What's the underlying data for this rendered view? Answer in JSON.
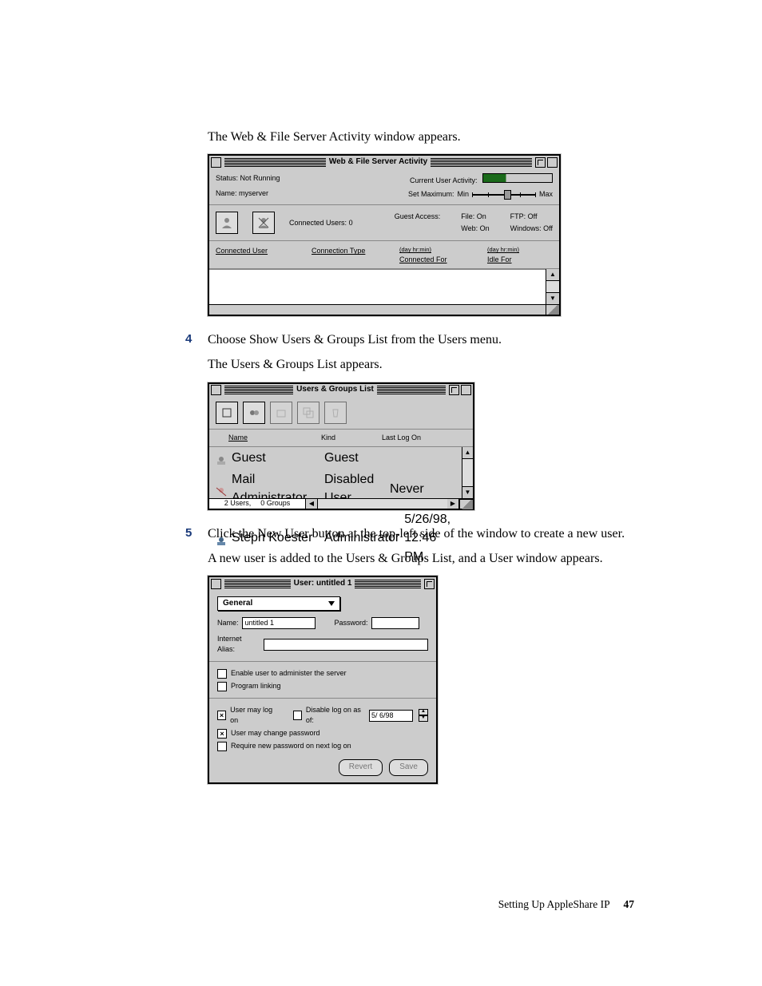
{
  "intro_text": "The Web & File Server Activity window appears.",
  "step4": {
    "num": "4",
    "line1": "Choose Show Users & Groups List from the Users menu.",
    "line2": "The Users & Groups List appears."
  },
  "step5": {
    "num": "5",
    "line1": "Click the New User button at the top-left side of the window to create a new user.",
    "line2": "A new user is added to the Users & Groups List, and a User window appears."
  },
  "activity_window": {
    "title": "Web & File Server Activity",
    "status_label": "Status:",
    "status_value": "Not Running",
    "name_label": "Name:",
    "name_value": "myserver",
    "cur_activity_label": "Current User Activity:",
    "set_max_label": "Set Maximum:",
    "set_min": "Min",
    "set_max": "Max",
    "connected_users_label": "Connected Users:",
    "connected_users_value": "0",
    "guest_access_label": "Guest Access:",
    "file_label": "File:",
    "file_value": "On",
    "web_label": "Web:",
    "web_value": "On",
    "ftp_label": "FTP:",
    "ftp_value": "Off",
    "windows_label": "Windows:",
    "windows_value": "Off",
    "col_connected_user": "Connected User",
    "col_connection_type": "Connection Type",
    "col_connected_for": "Connected For",
    "col_idle_for": "Idle For",
    "dhm": "(day hr:min)"
  },
  "users_window": {
    "title": "Users & Groups List",
    "col_name": "Name",
    "col_kind": "Kind",
    "col_last": "Last Log On",
    "rows": [
      {
        "name": "Guest",
        "kind": "Guest",
        "last": ""
      },
      {
        "name": "Mail Administrator",
        "kind": "Disabled User",
        "last": "Never"
      },
      {
        "name": "Steph Koester",
        "kind": "Administrator",
        "last": "5/26/98, 12:46 PM"
      }
    ],
    "status_users": "2 Users,",
    "status_groups": "0 Groups"
  },
  "user_window": {
    "title": "User: untitled 1",
    "popup": "General",
    "name_label": "Name:",
    "name_value": "untitled 1",
    "password_label": "Password:",
    "alias_label": "Internet Alias:",
    "chk_admin": "Enable user to administer the server",
    "chk_proglink": "Program linking",
    "chk_logon": "User may log on",
    "chk_disable": "Disable log on as of:",
    "disable_date": "5/ 6/98",
    "chk_changepwd": "User may change password",
    "chk_requirepwd": "Require new password on next log on",
    "btn_revert": "Revert",
    "btn_save": "Save"
  },
  "footer": {
    "text": "Setting Up AppleShare IP",
    "page": "47"
  }
}
